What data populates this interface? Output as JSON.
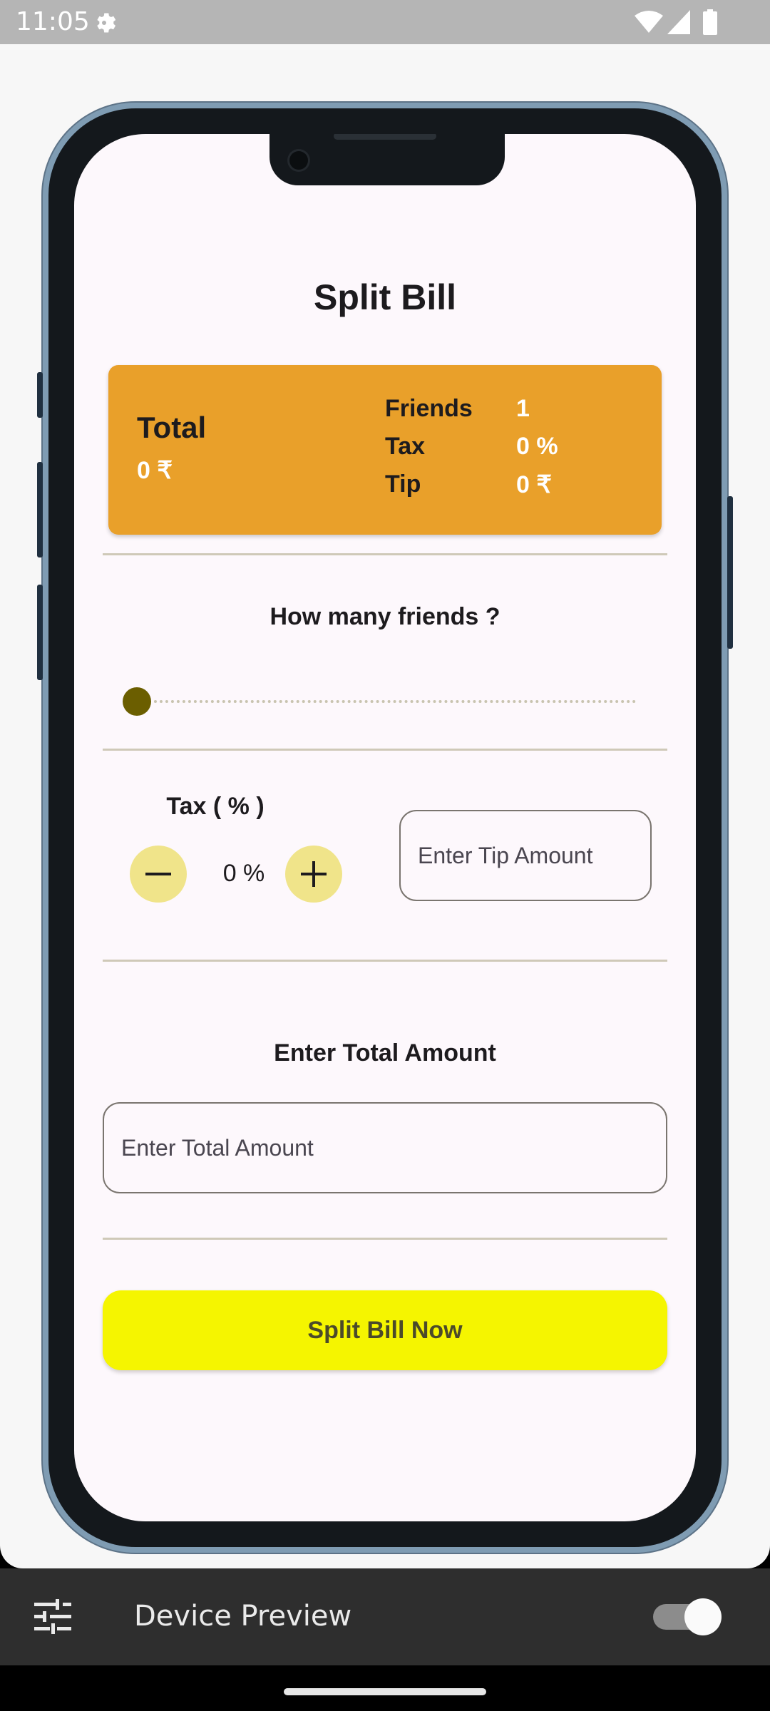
{
  "status_bar": {
    "time": "11:05"
  },
  "app": {
    "title": "Split Bill",
    "summary": {
      "total_label": "Total",
      "total_value": "0 ₹",
      "rows": [
        {
          "label": "Friends",
          "value": "1"
        },
        {
          "label": "Tax",
          "value": "0 %"
        },
        {
          "label": "Tip",
          "value": "0 ₹"
        }
      ]
    },
    "friends": {
      "heading": "How many friends ?",
      "slider_value": 1
    },
    "tax": {
      "label": "Tax ( % )",
      "value": "0 %"
    },
    "tip": {
      "placeholder": "Enter Tip Amount"
    },
    "total_amount": {
      "heading": "Enter Total Amount",
      "placeholder": "Enter Total Amount"
    },
    "split_button_label": "Split Bill Now"
  },
  "bottom_bar": {
    "label": "Device Preview",
    "toggle_on": true
  },
  "colors": {
    "summary_card": "#e9a02a",
    "split_button": "#f5f500",
    "stepper_button": "#f0e48a",
    "slider_thumb": "#6b5e00"
  }
}
